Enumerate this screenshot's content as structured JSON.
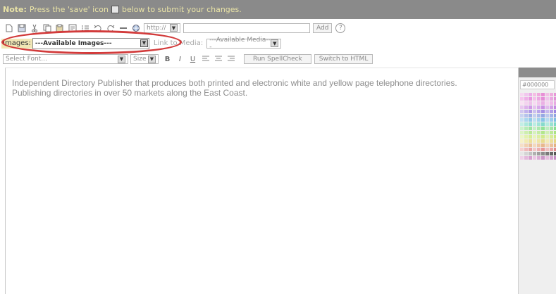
{
  "note": {
    "prefix": "Note:",
    "text_before": "Press the 'save' icon",
    "text_after": "below to submit your changes."
  },
  "toolbar_row1": {
    "icons": [
      "new-document-icon",
      "save-icon",
      "cut-icon",
      "copy-icon",
      "paste-icon",
      "paste-word-icon",
      "list-icon",
      "undo-icon",
      "redo-icon",
      "horizontal-rule-icon",
      "link-icon"
    ],
    "protocol_value": "http://",
    "url_value": "",
    "add_label": "Add",
    "help_label": "?"
  },
  "toolbar_row2": {
    "images_label": "Images:",
    "images_selected": "---Available Images---",
    "link_media_label": "Link to Media:",
    "media_selected": "---Available Media---"
  },
  "toolbar_row3": {
    "font_selected": "Select Font...",
    "size_selected": "Size",
    "bold": "B",
    "italic": "I",
    "underline": "U",
    "spellcheck_label": "Run SpellCheck",
    "html_label": "Switch to HTML"
  },
  "editor": {
    "content": "Independent Directory Publisher that produces both printed and electronic white and yellow page telephone directories. Publishing directories in over 50 markets along the East Coast."
  },
  "palette": {
    "hex_value": "#000000",
    "colors": [
      "#f7d7f1",
      "#f2c5ee",
      "#ecaee8",
      "#f5bde4",
      "#f0a8dd",
      "#e88fd6",
      "#f3c1e6",
      "#eeaedf",
      "#e796d8",
      "#f1b8e4",
      "#f6c4ee",
      "#efafe8",
      "#e897df",
      "#f4bfea",
      "#eda6e1",
      "#e58dd8",
      "#f1c4ec",
      "#eaa8e2",
      "#e292d8",
      "#efbde9",
      "#f9e1f3",
      "#f4d2ef",
      "#eec2ea",
      "#f8d9f3",
      "#f2c4ec",
      "#ebb0e5",
      "#f5d2f0",
      "#efbde9",
      "#e8a8e2",
      "#f4cdee",
      "#e9c7ef",
      "#ddb1eb",
      "#d09ae6",
      "#e6c1ef",
      "#d9a9ea",
      "#cb91e4",
      "#e2bbed",
      "#d4a1e8",
      "#c689e2",
      "#dfb6ec",
      "#d2c6f0",
      "#c1b1ec",
      "#ae99e6",
      "#ccc0ef",
      "#b9a6ea",
      "#a58fe4",
      "#c7b9ed",
      "#b29ee7",
      "#9d86e1",
      "#c2b3ec",
      "#c9d3f1",
      "#b5c2ec",
      "#9fb1e6",
      "#c4cff0",
      "#acbcea",
      "#95a8e4",
      "#bdc9ee",
      "#a4b5e8",
      "#8ea2e2",
      "#b8c6ed",
      "#c3e2f3",
      "#abd6ef",
      "#92cae9",
      "#bde0f2",
      "#a3d2ed",
      "#88c4e7",
      "#b7dcf1",
      "#9ccdeb",
      "#80bfe5",
      "#b1d9ef",
      "#c2efe6",
      "#aae8dc",
      "#92e0d2",
      "#bbede3",
      "#a0e4d7",
      "#86dbcc",
      "#b5ebe0",
      "#99e2d3",
      "#7ed8c8",
      "#afe8dd",
      "#cbf2cc",
      "#b5ecb7",
      "#9ee5a2",
      "#c4f0c6",
      "#abe9ae",
      "#93e298",
      "#bdeec0",
      "#a3e6a7",
      "#8adf90",
      "#b6ecba",
      "#dcf4c4",
      "#cdefad",
      "#bce996",
      "#d6f2bb",
      "#c5eca2",
      "#b2e68b",
      "#d0f0b4",
      "#bde998",
      "#aae382",
      "#cbeeae",
      "#ecf6c5",
      "#e3f2ae",
      "#d9ed97",
      "#e8f4bc",
      "#ddefa3",
      "#d2ea8c",
      "#e4f2b4",
      "#d8ec99",
      "#cce782",
      "#e0f0ad",
      "#f7f1c7",
      "#f2eab0",
      "#ede199",
      "#f5eebe",
      "#efe5a5",
      "#e9dc8e",
      "#f3ebb6",
      "#ecdf9b",
      "#e6d784",
      "#f1e8af",
      "#f6dfc6",
      "#f1d0af",
      "#ebc098",
      "#f4d9bd",
      "#eec8a4",
      "#e8b88d",
      "#f2d3b5",
      "#ebc19a",
      "#e4b183",
      "#efceae",
      "#f5cfcf",
      "#f0b9b9",
      "#eaa2a2",
      "#f3c7c7",
      "#edafaf",
      "#e69797",
      "#f1c0c0",
      "#eaa6a6",
      "#e38c8c",
      "#efbaba",
      "#e6e6e6",
      "#d4d4d4",
      "#c2c2c2",
      "#b0b0b0",
      "#9e9e9e",
      "#8c8c8c",
      "#7a7a7a",
      "#686868",
      "#565656",
      "#444444",
      "#f0d0e8",
      "#e4b8dc",
      "#d8a0d0",
      "#ecc6e4",
      "#dcaed6",
      "#cc96c8",
      "#e6bedf",
      "#d6a4d2",
      "#c68cc4",
      "#e0b6da"
    ]
  }
}
